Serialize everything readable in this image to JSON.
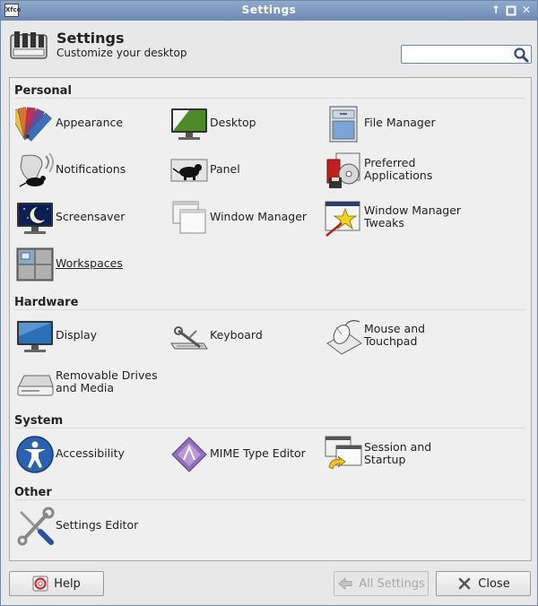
{
  "window": {
    "title": "Settings",
    "app_icon_text": "Xfce"
  },
  "header": {
    "title": "Settings",
    "subtitle": "Customize your desktop",
    "search_value": "",
    "search_placeholder": ""
  },
  "sections": [
    {
      "title": "Personal",
      "items": [
        {
          "label": "Appearance",
          "icon": "palette-icon"
        },
        {
          "label": "Desktop",
          "icon": "desktop-monitor-icon"
        },
        {
          "label": "File Manager",
          "icon": "file-cabinet-icon"
        },
        {
          "label": "Notifications",
          "icon": "notification-mouse-icon"
        },
        {
          "label": "Panel",
          "icon": "panel-mouse-icon"
        },
        {
          "label": "Preferred\nApplications",
          "icon": "preferred-apps-icon"
        },
        {
          "label": "Screensaver",
          "icon": "screensaver-moon-icon"
        },
        {
          "label": "Window Manager",
          "icon": "window-stack-icon"
        },
        {
          "label": "Window Manager\nTweaks",
          "icon": "window-star-wand-icon"
        },
        {
          "label": "Workspaces",
          "icon": "workspaces-grid-icon"
        }
      ]
    },
    {
      "title": "Hardware",
      "items": [
        {
          "label": "Display",
          "icon": "display-monitor-icon"
        },
        {
          "label": "Keyboard",
          "icon": "keyboard-wrench-icon"
        },
        {
          "label": "Mouse and\nTouchpad",
          "icon": "mouse-touchpad-icon"
        },
        {
          "label": "Removable Drives\nand Media",
          "icon": "removable-drive-icon"
        }
      ]
    },
    {
      "title": "System",
      "items": [
        {
          "label": "Accessibility",
          "icon": "accessibility-person-icon"
        },
        {
          "label": "MIME Type Editor",
          "icon": "mime-type-icon"
        },
        {
          "label": "Session and\nStartup",
          "icon": "session-startup-icon"
        }
      ]
    },
    {
      "title": "Other",
      "items": [
        {
          "label": "Settings Editor",
          "icon": "screwdriver-wrench-icon"
        }
      ]
    }
  ],
  "buttons": {
    "help": "Help",
    "all_settings": "All Settings",
    "close": "Close"
  }
}
